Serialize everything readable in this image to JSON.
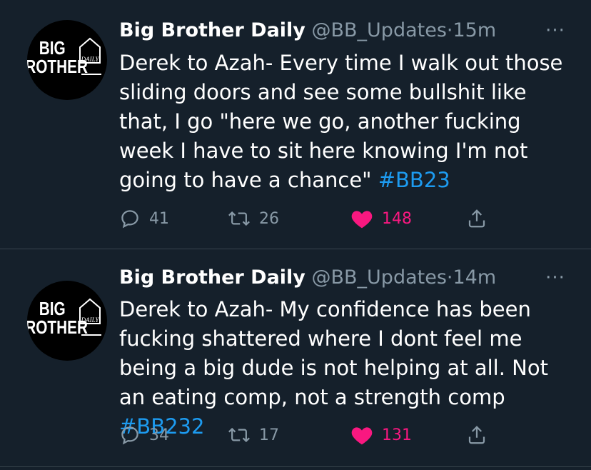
{
  "colors": {
    "background": "#15202b",
    "text": "#ffffff",
    "muted": "#8899a6",
    "hashtag": "#1d9bf0",
    "like": "#f91880",
    "divider": "#38444d"
  },
  "avatar": {
    "logo_text_big": "BIG",
    "logo_text_brother": "BROTHER",
    "logo_text_daily": "DAILY"
  },
  "tweets": [
    {
      "author_name": "Big Brother Daily",
      "handle": "@BB_Updates",
      "separator": "·",
      "time": "15m",
      "more_icon": "···",
      "text": "Derek to Azah- Every time I walk out those sliding doors and see some bullshit like that, I go \"here we go, another fucking week I have to sit here knowing I'm not going to have a chance\" ",
      "hashtag": "#BB23",
      "replies": "41",
      "retweets": "26",
      "likes": "148",
      "liked": true
    },
    {
      "author_name": "Big Brother Daily",
      "handle": "@BB_Updates",
      "separator": "·",
      "time": "14m",
      "more_icon": "···",
      "text": "Derek to Azah- My confidence has been fucking shattered where I dont feel me being a big dude is not helping at all. Not an eating comp, not a strength comp ",
      "hashtag": "#BB232",
      "replies": "34",
      "retweets": "17",
      "likes": "131",
      "liked": true
    }
  ]
}
